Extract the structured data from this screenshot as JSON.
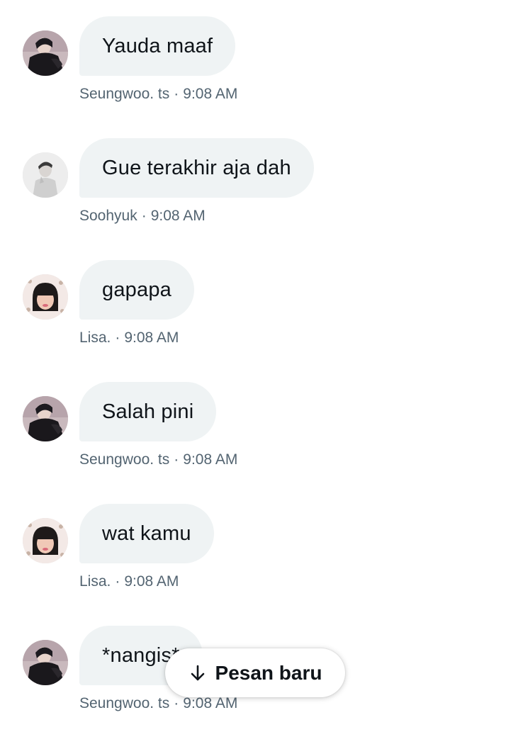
{
  "messages": [
    {
      "text": "Yauda maaf",
      "sender": "Seungwoo. ts",
      "time": "9:08 AM",
      "avatar": "seungwoo-avatar"
    },
    {
      "text": "Gue terakhir aja dah",
      "sender": "Soohyuk",
      "time": "9:08 AM",
      "avatar": "soohyuk-avatar"
    },
    {
      "text": "gapapa",
      "sender": "Lisa.",
      "time": "9:08 AM",
      "avatar": "lisa-avatar"
    },
    {
      "text": "Salah pini",
      "sender": "Seungwoo. ts",
      "time": "9:08 AM",
      "avatar": "seungwoo-avatar"
    },
    {
      "text": "wat kamu",
      "sender": "Lisa.",
      "time": "9:08 AM",
      "avatar": "lisa-avatar"
    },
    {
      "text": "*nangis*",
      "sender": "Seungwoo. ts",
      "time": "9:08 AM",
      "avatar": "seungwoo-avatar"
    }
  ],
  "separator": "·",
  "new_messages_button": {
    "label": "Pesan baru",
    "icon": "arrow-down-icon"
  },
  "colors": {
    "bubble": "#eff3f4",
    "text": "#0f1419",
    "meta": "#536471",
    "background": "#ffffff"
  }
}
